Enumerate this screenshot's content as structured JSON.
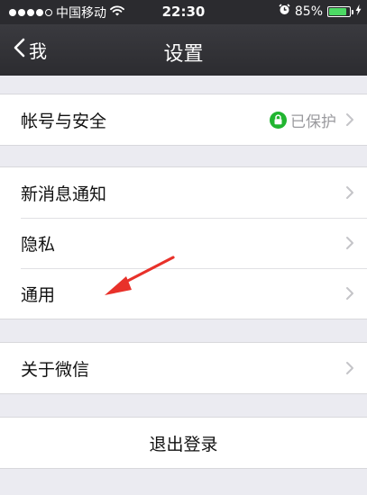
{
  "status_bar": {
    "carrier": "中国移动",
    "time": "22:30",
    "battery_percent": "85%",
    "battery_level": 0.85,
    "signal_bars": 4,
    "signal_total": 5
  },
  "nav": {
    "back_label": "我",
    "title": "设置"
  },
  "sections": {
    "account": {
      "label": "帐号与安全",
      "status": "已保护"
    },
    "notifications": {
      "label": "新消息通知"
    },
    "privacy": {
      "label": "隐私"
    },
    "general": {
      "label": "通用"
    },
    "about": {
      "label": "关于微信"
    },
    "logout": {
      "label": "退出登录"
    }
  },
  "icons": {
    "wifi": "wifi-icon",
    "alarm": "alarm-clock-icon",
    "charging": "charging-bolt-icon",
    "back": "chevron-left-icon",
    "row_arrow": "chevron-right-icon",
    "protected": "lock-icon"
  },
  "colors": {
    "status_bar_bg": "#2b2b2f",
    "nav_bg": "#333337",
    "page_bg": "#ebebf1",
    "protected_green": "#21b530",
    "battery_green": "#4cd964",
    "annotation_red": "#e8312a"
  }
}
